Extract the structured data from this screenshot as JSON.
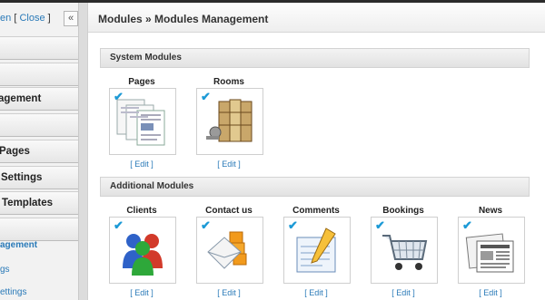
{
  "sidebar": {
    "open_label": "en",
    "bracket_sep": "[",
    "close_label": "Close",
    "bracket_end": "]",
    "collapse_label": "«",
    "items": [
      {
        "label": ""
      },
      {
        "label": ""
      },
      {
        "label": "agement"
      },
      {
        "label": ""
      },
      {
        "label": "Pages"
      },
      {
        "label": "Settings"
      },
      {
        "label": " Templates"
      },
      {
        "label": ""
      }
    ],
    "links": [
      {
        "label": "agement"
      },
      {
        "label": "gs"
      },
      {
        "label": "ettings"
      }
    ]
  },
  "header": {
    "title": "Modules » Modules Management"
  },
  "sections": {
    "system": {
      "title": "System Modules",
      "modules": [
        {
          "name": "Pages",
          "edit": "[ Edit ]",
          "icon": "pages-icon"
        },
        {
          "name": "Rooms",
          "edit": "[ Edit ]",
          "icon": "rooms-icon"
        }
      ]
    },
    "additional": {
      "title": "Additional Modules",
      "modules": [
        {
          "name": "Clients",
          "edit": "[ Edit ]",
          "icon": "clients-icon"
        },
        {
          "name": "Contact us",
          "edit": "[ Edit ]",
          "icon": "contact-us-icon"
        },
        {
          "name": "Comments",
          "edit": "[ Edit ]",
          "icon": "comments-icon"
        },
        {
          "name": "Bookings",
          "edit": "[ Edit ]",
          "icon": "shopping-cart-icon"
        },
        {
          "name": "News",
          "edit": "[ Edit ]",
          "icon": "newspaper-icon"
        }
      ]
    }
  },
  "colors": {
    "link": "#2a7ab8",
    "check": "#1c9ad6"
  }
}
